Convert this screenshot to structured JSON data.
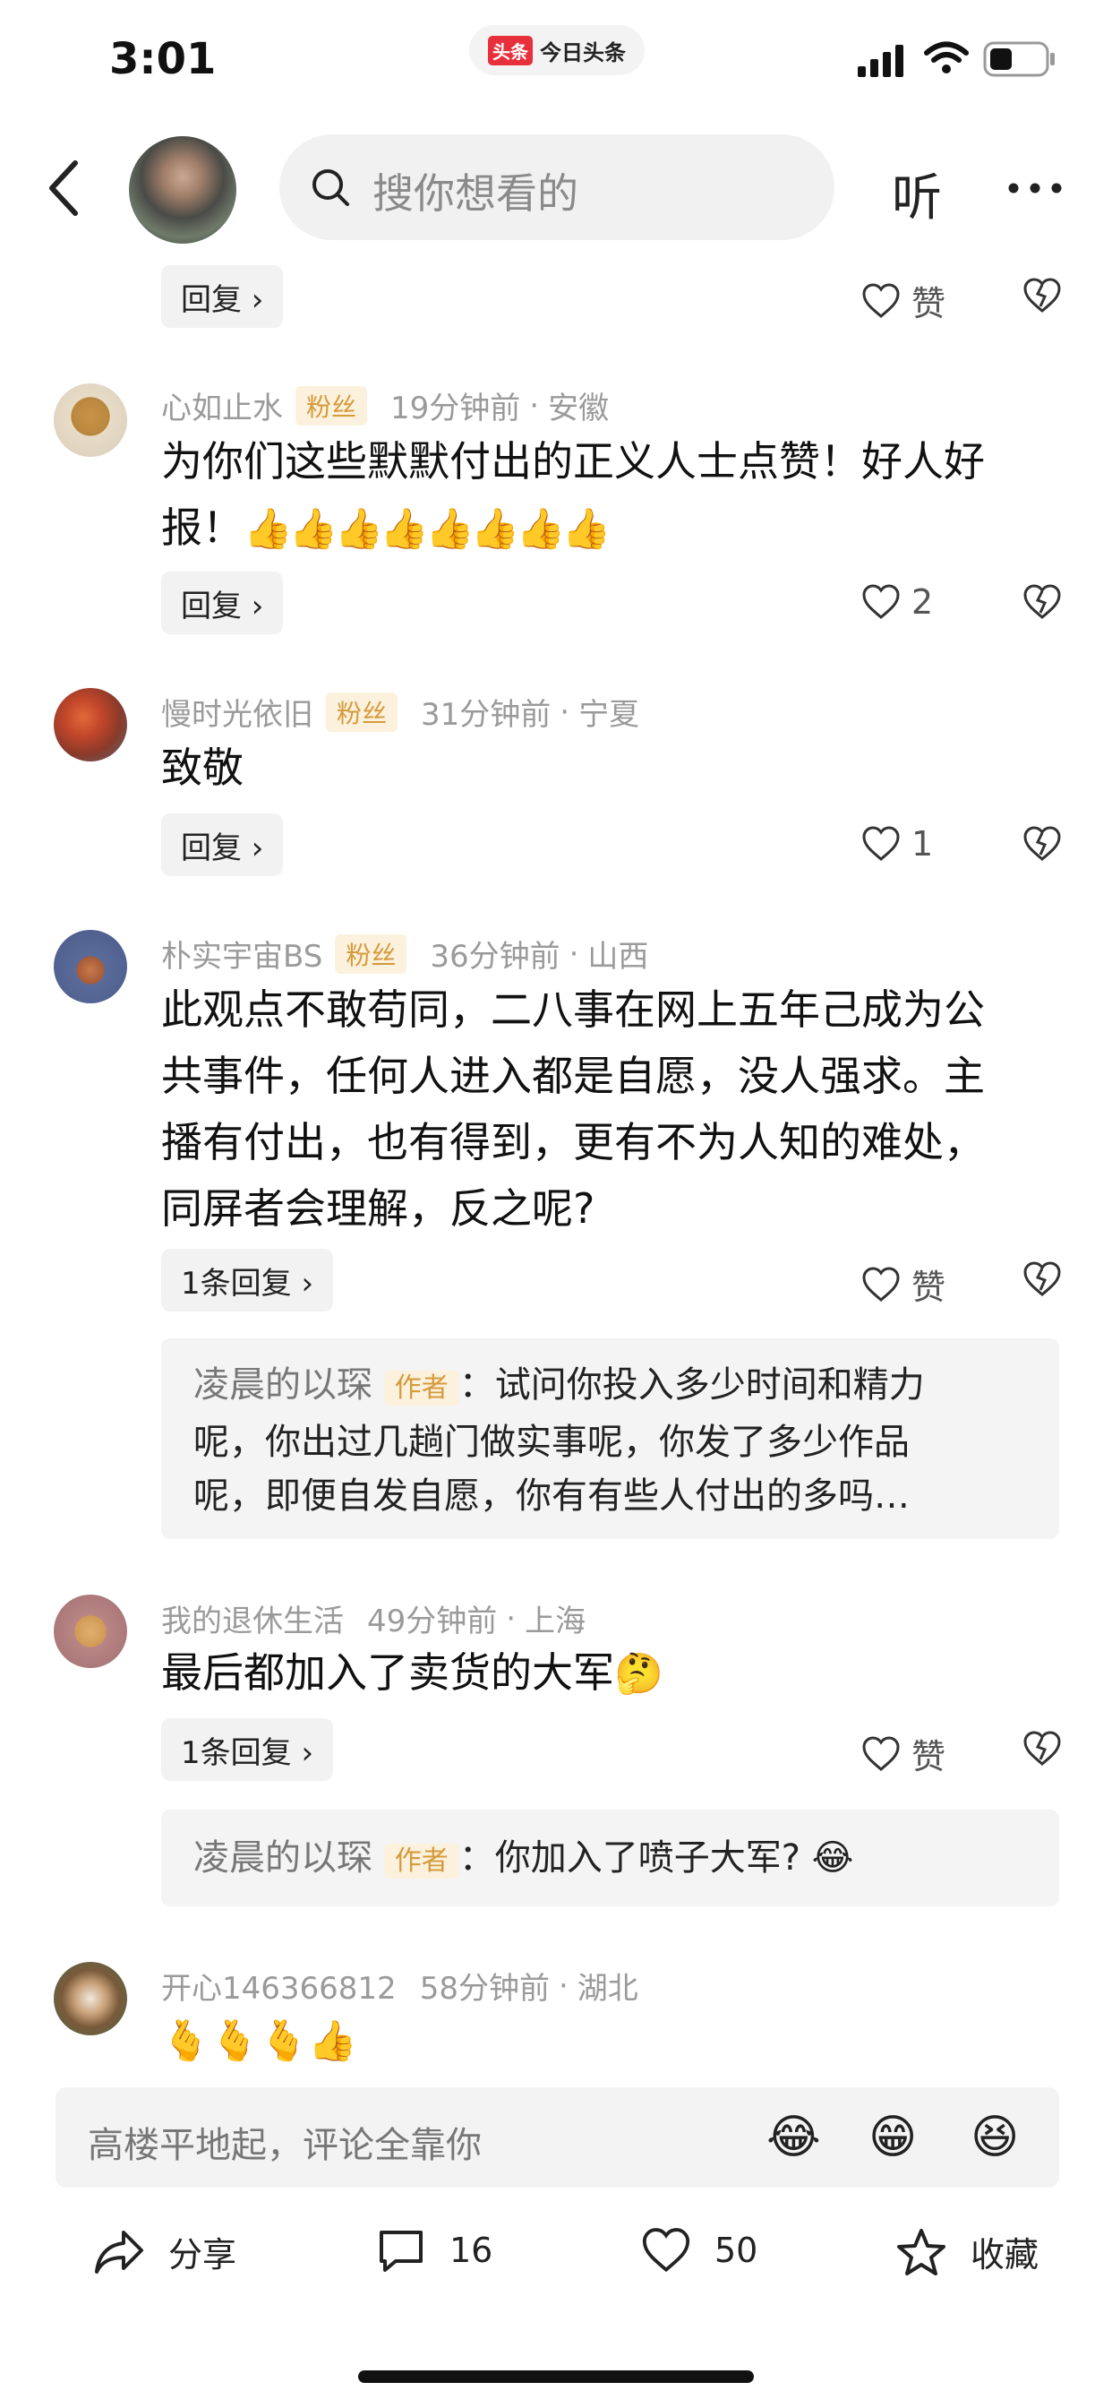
{
  "status_bar": {
    "time": "3:01",
    "app_logo": "头条",
    "app_name": "今日头条"
  },
  "header": {
    "search_placeholder": "搜你想看的",
    "listen_label": "听"
  },
  "top_reply": {
    "reply_label": "回复 ›",
    "like_label": "赞"
  },
  "comments": [
    {
      "username": "心如止水",
      "fan_badge": "粉丝",
      "time": "19分钟前",
      "sep": "·",
      "location": "安徽",
      "text_line1": "为你们这些默默付出的正义人士点赞！好人好",
      "text_line2": "报！",
      "emoji": "👍👍👍👍👍👍👍👍",
      "reply_label": "回复 ›",
      "like_count": "2"
    },
    {
      "username": "慢时光依旧",
      "fan_badge": "粉丝",
      "time": "31分钟前",
      "sep": "·",
      "location": "宁夏",
      "text": "致敬",
      "reply_label": "回复 ›",
      "like_count": "1"
    },
    {
      "username": "朴实宇宙BS",
      "fan_badge": "粉丝",
      "time": "36分钟前",
      "sep": "·",
      "location": "山西",
      "text_lines": [
        "此观点不敢苟同，二八事在网上五年己成为公",
        "共事件，任何人进入都是自愿，没人强求。主",
        "播有付出，也有得到，更有不为人知的难处，",
        "同屏者会理解，反之呢?"
      ],
      "reply_label": "1条回复 ›",
      "like_label": "赞",
      "sub_reply": {
        "name": "凌晨的以琛",
        "tag": "作者",
        "lines": [
          "：试问你投入多少时间和精力",
          "呢，你出过几趟门做实事呢，你发了多少作品",
          "呢，即便自发自愿，你有有些人付出的多吗…"
        ]
      }
    },
    {
      "username": "我的退休生活",
      "time": "49分钟前",
      "sep": "·",
      "location": "上海",
      "text": "最后都加入了卖货的大军",
      "emoji": "🤔",
      "reply_label": "1条回复 ›",
      "like_label": "赞",
      "sub_reply": {
        "name": "凌晨的以琛",
        "tag": "作者",
        "text": "：你加入了喷子大军?",
        "emoji": "😂"
      }
    },
    {
      "username": "开心146366812",
      "time": "58分钟前",
      "sep": "·",
      "location": "湖北",
      "emoji": "🫰🫰🫰👍"
    }
  ],
  "input": {
    "placeholder": "高楼平地起，评论全靠你",
    "emojis": [
      "😂",
      "😁",
      "😆"
    ]
  },
  "actions": {
    "share_label": "分享",
    "comment_count": "16",
    "like_count": "50",
    "favorite_label": "收藏"
  }
}
